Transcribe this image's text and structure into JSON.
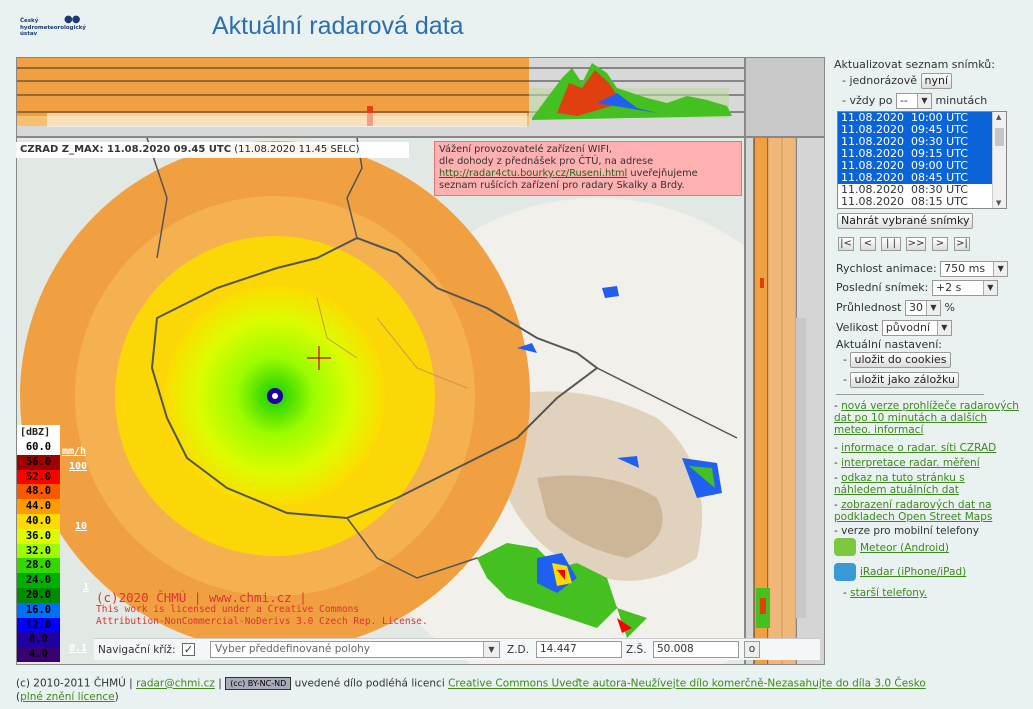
{
  "header": {
    "logo_text": "Český\nhydrometeorologický\nústav",
    "title": "Aktuální radarová data"
  },
  "map": {
    "info_label": "CZRAD Z_MAX: 11.08.2020 09.45 UTC",
    "info_local": "(11.08.2020 11.45 SELC)",
    "notice_line1": "Vážení provozovatelé zařízení WIFI,",
    "notice_line2": "dle dohody z přednášek pro ČTÚ, na adrese",
    "notice_link": "http://radar4ctu.bourky.cz/Ruseni.html",
    "notice_line3_rest": " uveřejňujeme",
    "notice_line4": "seznam rušících zařízení pro radary Skalky a Brdy.",
    "copyright_main": "(c)2020 ČHMÚ | www.chmi.cz |",
    "copyright_l2": "This work is licensed under a Creative Commons",
    "copyright_l3": "Attribution-NonCommercial-NoDerivs 3.0 Czech Rep. License."
  },
  "legend": {
    "unit": "[dBZ]",
    "mmh_label": "mm/h",
    "mmh_marks": [
      "100",
      "10",
      "1",
      "0.1"
    ],
    "rows": [
      {
        "v": "60.0",
        "bg": "#ffffff",
        "fg": "#000000"
      },
      {
        "v": "56.0",
        "bg": "#a00000",
        "fg": "#000000"
      },
      {
        "v": "52.0",
        "bg": "#fc0000",
        "fg": "#000000"
      },
      {
        "v": "48.0",
        "bg": "#fc5800",
        "fg": "#000000"
      },
      {
        "v": "44.0",
        "bg": "#fc9c00",
        "fg": "#000000"
      },
      {
        "v": "40.0",
        "bg": "#fcdc00",
        "fg": "#000000"
      },
      {
        "v": "36.0",
        "bg": "#dcfc00",
        "fg": "#000000"
      },
      {
        "v": "32.0",
        "bg": "#9cfc00",
        "fg": "#000000"
      },
      {
        "v": "28.0",
        "bg": "#34d800",
        "fg": "#000000"
      },
      {
        "v": "24.0",
        "bg": "#00b000",
        "fg": "#000000"
      },
      {
        "v": "20.0",
        "bg": "#008c00",
        "fg": "#000000"
      },
      {
        "v": "16.0",
        "bg": "#0070fc",
        "fg": "#000000"
      },
      {
        "v": "12.0",
        "bg": "#0000fc",
        "fg": "#000000"
      },
      {
        "v": "8.0",
        "bg": "#2000a0",
        "fg": "#000000"
      },
      {
        "v": "4.0",
        "bg": "#380070",
        "fg": "#000000"
      }
    ]
  },
  "navbar": {
    "cross_label": "Navigační kříž:",
    "cross_checked": "✓",
    "preset_placeholder": "Vyber předdefinované polohy",
    "lon_label": "Z.D.",
    "lon_value": "14.447",
    "lat_label": "Z.Š.",
    "lat_value": "50.008",
    "go_label": "o"
  },
  "panel": {
    "update_title": "Aktualizovat seznam snímků:",
    "once_label": "- jednorázově",
    "once_btn": "nyní",
    "every_label": "- vždy po",
    "every_value": "--",
    "every_unit": "minutách",
    "frames": [
      {
        "t": "11.08.2020  10:00 UTC",
        "sel": true
      },
      {
        "t": "11.08.2020  09:45 UTC",
        "sel": true
      },
      {
        "t": "11.08.2020  09:30 UTC",
        "sel": true
      },
      {
        "t": "11.08.2020  09:15 UTC",
        "sel": true
      },
      {
        "t": "11.08.2020  09:00 UTC",
        "sel": true
      },
      {
        "t": "11.08.2020  08:45 UTC",
        "sel": true
      },
      {
        "t": "11.08.2020  08:30 UTC",
        "sel": false
      },
      {
        "t": "11.08.2020  08:15 UTC",
        "sel": false
      }
    ],
    "load_btn": "Nahrát vybrané snímky",
    "anim_buttons": [
      "|<",
      "<",
      "| |",
      ">>",
      ">",
      ">|"
    ],
    "speed_label": "Rychlost animace:",
    "speed_value": "750 ms",
    "last_label": "Poslední snímek:",
    "last_value": "+2 s",
    "opacity_label": "Průhlednost",
    "opacity_value": "30",
    "opacity_unit": "%",
    "size_label": "Velikost",
    "size_value": "původní",
    "settings_label": "Aktuální nastavení:",
    "save_cookies": "uložit do cookies",
    "save_bookmark": "uložit jako záložku",
    "link_new_version": "nová verze prohlížeče radarových dat po 10 minutách a dalších meteo. informací",
    "link_info": "informace o radar. síti CZRAD",
    "link_interp": "interpretace radar. měření",
    "link_this_page": "odkaz na tuto stránku s náhledem atuálních dat",
    "link_osm": "zobrazení radarových dat na podkladech Open Street Maps",
    "mobile_label": "- verze pro mobilní telefony",
    "android_link": "Meteor (Android)",
    "iradar_link": "iRadar (iPhone/iPad)",
    "older_phones": "starší telefony."
  },
  "footer": {
    "copy": "(c) 2010-2011 ČHMÚ |",
    "email": "radar@chmi.cz",
    "sep": "|",
    "cc_badge": "(cc) BY-NC-ND",
    "license_text": "uvedené dílo podléhá licenci",
    "license_link": "Creative Commons Uveďte autora-Neužívejte dílo komerčně-Nezasahujte do díla 3.0 Česko",
    "full_license_link": "plné znění licence"
  },
  "colors": {
    "accent": "#2a6fb0",
    "link": "#3c8a1c",
    "selection": "#0a64d8",
    "radar_orange": "#f0a040"
  }
}
